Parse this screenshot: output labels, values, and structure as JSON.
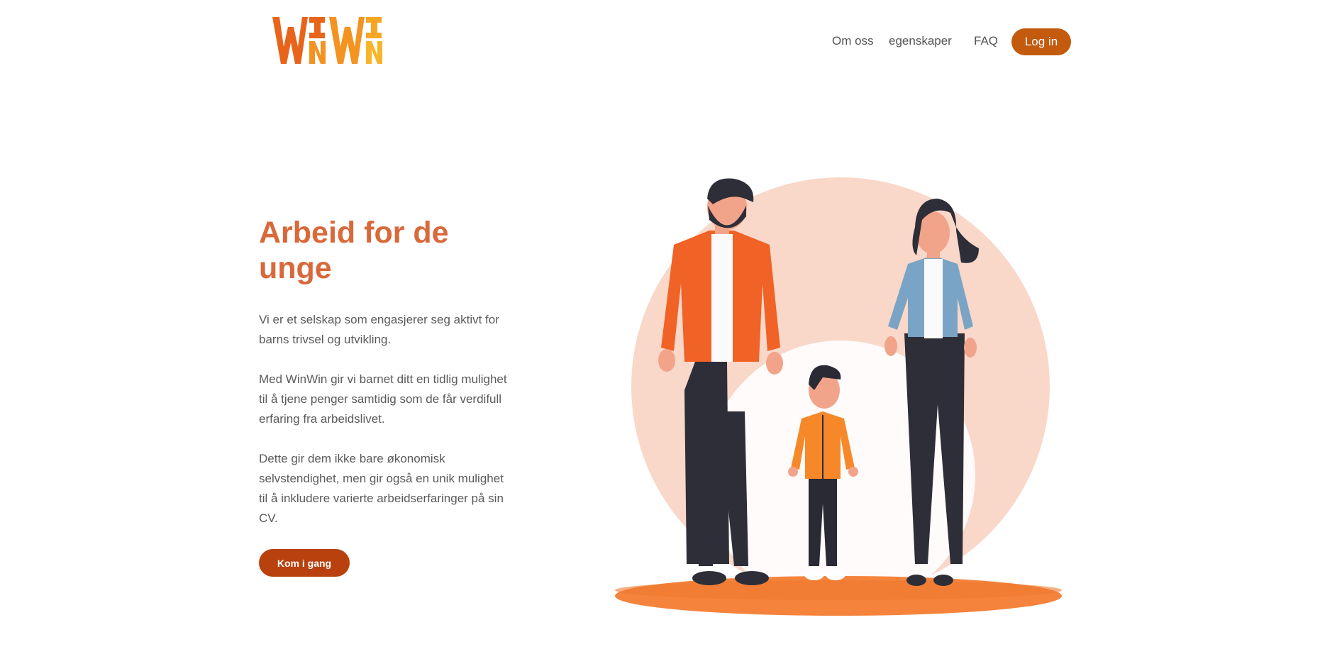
{
  "header": {
    "logo_alt": "WinWin",
    "nav": [
      {
        "label": "Om oss"
      },
      {
        "label": "egenskaper"
      },
      {
        "label": "FAQ"
      }
    ],
    "login_label": "Log in"
  },
  "hero": {
    "title": "Arbeid for de unge",
    "paragraphs": [
      "Vi er et selskap som engasjerer seg aktivt for barns trivsel og utvikling.",
      "Med WinWin gir vi barnet ditt en tidlig mulighet til å tjene penger samtidig som de får verdifull erfaring fra arbeidslivet.",
      "Dette gir dem ikke bare økonomisk selvstendighet, men gir også en unik mulighet til å inkludere varierte arbeidserfaringer på sin CV."
    ],
    "cta_label": "Kom i gang"
  },
  "colors": {
    "brand_orange": "#e8641a",
    "brand_yellow": "#f5a623",
    "title": "#d9693a",
    "button": "#c45a0e",
    "cta": "#b8410d"
  }
}
